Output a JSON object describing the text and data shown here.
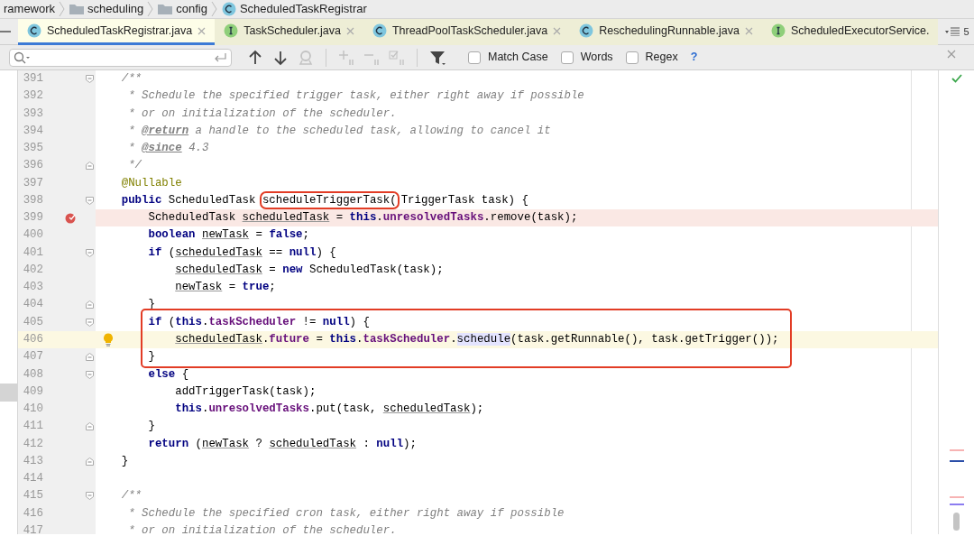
{
  "breadcrumb": [
    {
      "kind": "text",
      "label": "ramework"
    },
    {
      "kind": "folder",
      "label": "scheduling"
    },
    {
      "kind": "folder",
      "label": "config"
    },
    {
      "kind": "class",
      "label": "ScheduledTaskRegistrar"
    }
  ],
  "tabs": [
    {
      "label": "ScheduledTaskRegistrar.java",
      "kind": "class",
      "selected": true,
      "closable": true
    },
    {
      "label": "TaskScheduler.java",
      "kind": "interface",
      "selected": false,
      "closable": true
    },
    {
      "label": "ThreadPoolTaskScheduler.java",
      "kind": "class",
      "selected": false,
      "closable": true
    },
    {
      "label": "ReschedulingRunnable.java",
      "kind": "class",
      "selected": false,
      "closable": true
    },
    {
      "label": "ScheduledExecutorService.",
      "kind": "interface",
      "selected": false,
      "closable": false
    }
  ],
  "hidden_tabs_count": "5",
  "find_bar": {
    "tools": [
      {
        "kind": "up",
        "disabled": false
      },
      {
        "kind": "down",
        "disabled": false
      },
      {
        "kind": "find-all",
        "disabled": true
      },
      {
        "kind": "add",
        "disabled": true
      },
      {
        "kind": "remove",
        "disabled": true
      },
      {
        "kind": "select",
        "disabled": true
      },
      {
        "kind": "filter",
        "disabled": false
      }
    ],
    "options": [
      {
        "label": "Match Case",
        "checked": false
      },
      {
        "label": "Words",
        "checked": false
      },
      {
        "label": "Regex",
        "checked": false
      }
    ],
    "help": "?"
  },
  "lines": [
    {
      "number": "391",
      "kind": "code",
      "fold_start": true,
      "tokens": [
        {
          "kind": "comment",
          "text": "    /**"
        }
      ]
    },
    {
      "number": "392",
      "kind": "code",
      "tokens": [
        {
          "kind": "comment",
          "text": "     * Schedule the specified trigger task, either right away if possible"
        }
      ]
    },
    {
      "number": "393",
      "kind": "code",
      "tokens": [
        {
          "kind": "comment",
          "text": "     * or on initialization of the scheduler."
        }
      ]
    },
    {
      "number": "394",
      "kind": "code",
      "tokens": [
        {
          "kind": "comment",
          "text": "     * "
        },
        {
          "kind": "doctag",
          "text": "@return"
        },
        {
          "kind": "comment",
          "text": " a handle to the scheduled task, allowing to cancel it"
        }
      ]
    },
    {
      "number": "395",
      "kind": "code",
      "tokens": [
        {
          "kind": "comment",
          "text": "     * "
        },
        {
          "kind": "doctag",
          "text": "@since"
        },
        {
          "kind": "comment",
          "text": " 4.3"
        }
      ]
    },
    {
      "number": "396",
      "kind": "code",
      "fold_end": true,
      "tokens": [
        {
          "kind": "comment",
          "text": "     */"
        }
      ]
    },
    {
      "number": "397",
      "kind": "code",
      "tokens": [
        {
          "kind": "annotation",
          "text": "    @Nullable"
        }
      ]
    },
    {
      "number": "398",
      "kind": "code",
      "fold_start": true,
      "tokens": [
        {
          "kind": "keyword",
          "text": "    public"
        },
        {
          "kind": "plain",
          "text": " ScheduledTask "
        },
        {
          "kind": "plain",
          "text": "scheduleTriggerTask(",
          "boxed": true
        },
        {
          "kind": "plain",
          "text": "TriggerTask task) {"
        }
      ]
    },
    {
      "number": "399",
      "kind": "breakpoint",
      "tokens": [
        {
          "kind": "plain",
          "text": "        ScheduledTask "
        },
        {
          "kind": "local",
          "text": "scheduledTask"
        },
        {
          "kind": "plain",
          "text": " = "
        },
        {
          "kind": "keyword",
          "text": "this"
        },
        {
          "kind": "plain",
          "text": "."
        },
        {
          "kind": "field",
          "text": "unresolvedTasks"
        },
        {
          "kind": "plain",
          "text": ".remove(task);"
        }
      ]
    },
    {
      "number": "400",
      "kind": "code",
      "tokens": [
        {
          "kind": "keyword",
          "text": "        boolean"
        },
        {
          "kind": "local",
          "text": " newTask"
        },
        {
          "kind": "plain",
          "text": " = "
        },
        {
          "kind": "keyword",
          "text": "false"
        },
        {
          "kind": "plain",
          "text": ";"
        }
      ]
    },
    {
      "number": "401",
      "kind": "code",
      "fold_start": true,
      "tokens": [
        {
          "kind": "keyword",
          "text": "        if"
        },
        {
          "kind": "plain",
          "text": " ("
        },
        {
          "kind": "local",
          "text": "scheduledTask"
        },
        {
          "kind": "plain",
          "text": " == "
        },
        {
          "kind": "keyword",
          "text": "null"
        },
        {
          "kind": "plain",
          "text": ") {"
        }
      ]
    },
    {
      "number": "402",
      "kind": "code",
      "tokens": [
        {
          "kind": "local",
          "text": "            scheduledTask"
        },
        {
          "kind": "plain",
          "text": " = "
        },
        {
          "kind": "keyword",
          "text": "new"
        },
        {
          "kind": "plain",
          "text": " ScheduledTask(task);"
        }
      ]
    },
    {
      "number": "403",
      "kind": "code",
      "tokens": [
        {
          "kind": "local",
          "text": "            newTask"
        },
        {
          "kind": "plain",
          "text": " = "
        },
        {
          "kind": "keyword",
          "text": "true"
        },
        {
          "kind": "plain",
          "text": ";"
        }
      ]
    },
    {
      "number": "404",
      "kind": "code",
      "fold_end": true,
      "tokens": [
        {
          "kind": "plain",
          "text": "        }"
        }
      ]
    },
    {
      "number": "405",
      "kind": "code",
      "fold_start": true,
      "in_box": true,
      "tokens": [
        {
          "kind": "keyword",
          "text": "        if"
        },
        {
          "kind": "plain",
          "text": " ("
        },
        {
          "kind": "keyword",
          "text": "this"
        },
        {
          "kind": "plain",
          "text": "."
        },
        {
          "kind": "field",
          "text": "taskScheduler"
        },
        {
          "kind": "plain",
          "text": " != "
        },
        {
          "kind": "keyword",
          "text": "null"
        },
        {
          "kind": "plain",
          "text": ") {"
        }
      ]
    },
    {
      "number": "406",
      "kind": "caret",
      "in_box": true,
      "tokens": [
        {
          "kind": "local",
          "text": "            scheduledTask"
        },
        {
          "kind": "plain",
          "text": "."
        },
        {
          "kind": "field",
          "text": "future"
        },
        {
          "kind": "plain",
          "text": " = "
        },
        {
          "kind": "keyword",
          "text": "this"
        },
        {
          "kind": "plain",
          "text": "."
        },
        {
          "kind": "field",
          "text": "taskScheduler"
        },
        {
          "kind": "plain",
          "text": "."
        },
        {
          "kind": "usage",
          "text": "schedule"
        },
        {
          "kind": "plain",
          "text": "(task.getRunnable(), task.getTrigger());"
        }
      ]
    },
    {
      "number": "407",
      "kind": "code",
      "fold_end": true,
      "in_box": true,
      "tokens": [
        {
          "kind": "plain",
          "text": "        }"
        }
      ]
    },
    {
      "number": "408",
      "kind": "code",
      "fold_start": true,
      "tokens": [
        {
          "kind": "keyword",
          "text": "        else"
        },
        {
          "kind": "plain",
          "text": " {"
        }
      ]
    },
    {
      "number": "409",
      "kind": "code",
      "tokens": [
        {
          "kind": "plain",
          "text": "            addTriggerTask(task);"
        }
      ]
    },
    {
      "number": "410",
      "kind": "code",
      "tokens": [
        {
          "kind": "keyword",
          "text": "            this"
        },
        {
          "kind": "plain",
          "text": "."
        },
        {
          "kind": "field",
          "text": "unresolvedTasks"
        },
        {
          "kind": "plain",
          "text": ".put(task, "
        },
        {
          "kind": "local",
          "text": "scheduledTask"
        },
        {
          "kind": "plain",
          "text": ");"
        }
      ]
    },
    {
      "number": "411",
      "kind": "code",
      "fold_end": true,
      "tokens": [
        {
          "kind": "plain",
          "text": "        }"
        }
      ]
    },
    {
      "number": "412",
      "kind": "code",
      "tokens": [
        {
          "kind": "keyword",
          "text": "        return"
        },
        {
          "kind": "plain",
          "text": " ("
        },
        {
          "kind": "local",
          "text": "newTask"
        },
        {
          "kind": "plain",
          "text": " ? "
        },
        {
          "kind": "local",
          "text": "scheduledTask"
        },
        {
          "kind": "plain",
          "text": " : "
        },
        {
          "kind": "keyword",
          "text": "null"
        },
        {
          "kind": "plain",
          "text": ");"
        }
      ]
    },
    {
      "number": "413",
      "kind": "code",
      "fold_end": true,
      "tokens": [
        {
          "kind": "plain",
          "text": "    }"
        }
      ]
    },
    {
      "number": "414",
      "kind": "code"
    },
    {
      "number": "415",
      "kind": "code",
      "fold_start": true,
      "tokens": [
        {
          "kind": "comment",
          "text": "    /**"
        }
      ]
    },
    {
      "number": "416",
      "kind": "code",
      "tokens": [
        {
          "kind": "comment",
          "text": "     * Schedule the specified cron task, either right away if possible"
        }
      ]
    },
    {
      "number": "417",
      "kind": "code",
      "tokens": [
        {
          "kind": "comment",
          "text": "     * or on initialization of the scheduler."
        }
      ]
    }
  ]
}
